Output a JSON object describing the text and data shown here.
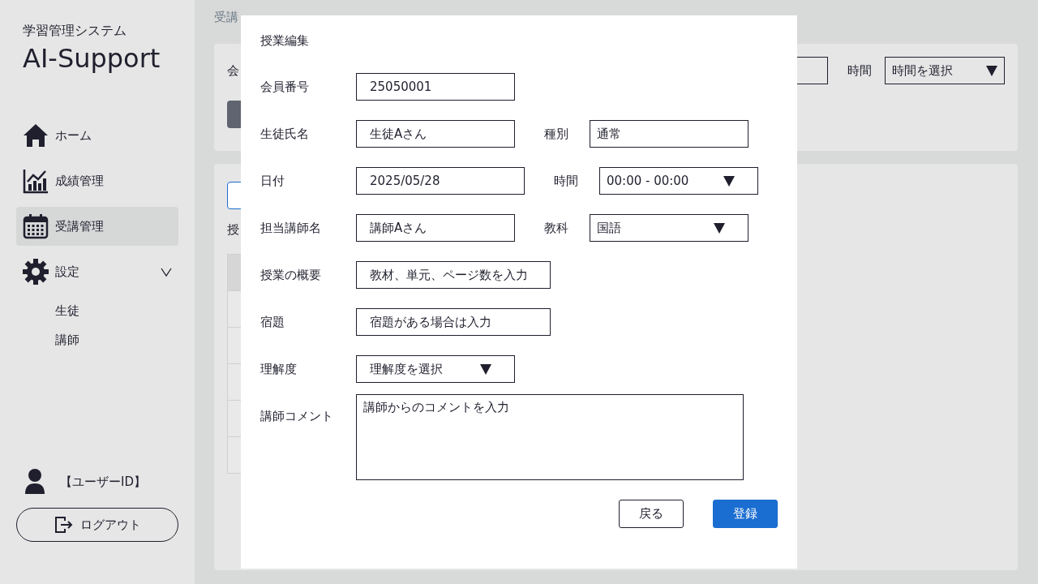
{
  "sidebar": {
    "subtitle": "学習管理システム",
    "title": "AI-Support",
    "nav": [
      {
        "kind": "home",
        "label": "ホーム",
        "selected": false
      },
      {
        "kind": "chart",
        "label": "成績管理",
        "selected": false
      },
      {
        "kind": "calendar",
        "label": "受講管理",
        "selected": true
      },
      {
        "kind": "gear",
        "label": "設定",
        "selected": false,
        "expanded": true,
        "children": [
          {
            "label": "生徒"
          },
          {
            "label": "講師"
          }
        ]
      }
    ],
    "user": {
      "name": "【ユーザーID】"
    },
    "logout": {
      "label": "ログアウト"
    }
  },
  "background": {
    "breadcrumb": "受講",
    "search_panel": {
      "label": "会",
      "time_label": "時間",
      "time_select": {
        "placeholder": "時間を選択"
      }
    },
    "list_panel": {
      "heading": "授"
    }
  },
  "modal": {
    "title": "授業編集",
    "rows": [
      {
        "fields": [
          {
            "kind": "text",
            "label": "会員番号",
            "value": "25050001"
          }
        ]
      },
      {
        "fields": [
          {
            "kind": "text",
            "label": "生徒氏名",
            "value": "生徒Aさん"
          },
          {
            "kind": "text",
            "label": "種別",
            "value": "通常"
          }
        ]
      },
      {
        "fields": [
          {
            "kind": "text",
            "label": "日付",
            "value": "2025/05/28"
          },
          {
            "kind": "select",
            "label": "時間",
            "value": "00:00 - 00:00"
          }
        ]
      },
      {
        "fields": [
          {
            "kind": "text",
            "label": "担当講師名",
            "value": "講師Aさん"
          },
          {
            "kind": "select",
            "label": "教科",
            "value": "国語"
          }
        ]
      },
      {
        "fields": [
          {
            "kind": "text",
            "label": "授業の概要",
            "placeholder": "教材、単元、ページ数を入力"
          }
        ]
      },
      {
        "fields": [
          {
            "kind": "text",
            "label": "宿題",
            "placeholder": "宿題がある場合は入力"
          }
        ]
      },
      {
        "fields": [
          {
            "kind": "select",
            "label": "理解度",
            "placeholder": "理解度を選択"
          }
        ]
      },
      {
        "fields": [
          {
            "kind": "textarea",
            "label": "講師コメント",
            "placeholder": "講師からのコメントを入力"
          }
        ]
      }
    ],
    "buttons": [
      {
        "kind": "secondary",
        "label": "戻る"
      },
      {
        "kind": "primary",
        "label": "登録"
      }
    ]
  }
}
